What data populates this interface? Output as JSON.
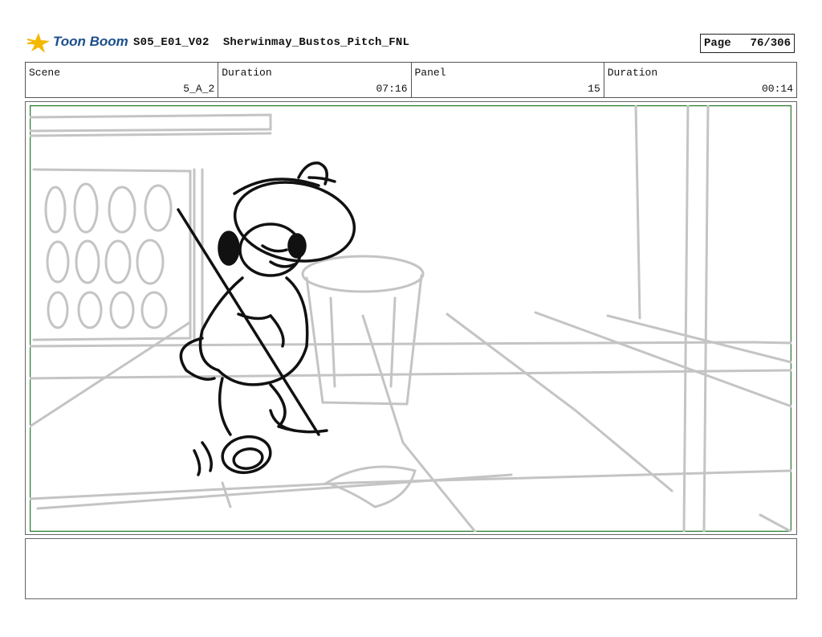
{
  "header": {
    "logo_text": "Toon Boom",
    "title": "S05_E01_V02  Sherwinmay_Bustos_Pitch_FNL",
    "page_label": "Page",
    "page_value": "76/306"
  },
  "info": {
    "scene_label": "Scene",
    "scene_value": "5_A_2",
    "duration_label": "Duration",
    "duration_value": "07:16",
    "panel_label": "Panel",
    "panel_value": "15",
    "panel_duration_label": "Duration",
    "panel_duration_value": "00:14"
  },
  "colors": {
    "panel_border": "#2e7d32",
    "logo_blue": "#1d4f8c",
    "logo_star": "#f5b800"
  },
  "notes": {
    "text": ""
  }
}
